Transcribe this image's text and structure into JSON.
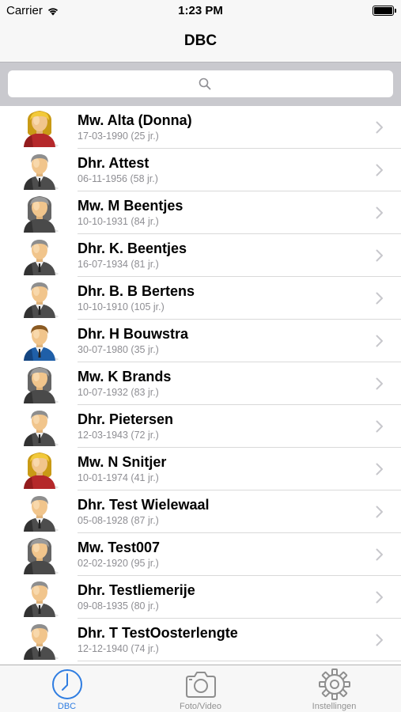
{
  "status_bar": {
    "carrier": "Carrier",
    "time": "1:23 PM"
  },
  "nav": {
    "title": "DBC"
  },
  "search": {
    "placeholder": ""
  },
  "patients": [
    {
      "name": "Mw. Alta (Donna)",
      "date": "17-03-1990 (25 jr.)",
      "avatar": "female-blonde-avatar-icon"
    },
    {
      "name": "Dhr. Attest",
      "date": "06-11-1956 (58 jr.)",
      "avatar": "male-grey-hair-avatar-icon"
    },
    {
      "name": "Mw. M Beentjes",
      "date": "10-10-1931 (84 jr.)",
      "avatar": "female-grey-hair-avatar-icon"
    },
    {
      "name": "Dhr. K. Beentjes",
      "date": "16-07-1934 (81 jr.)",
      "avatar": "male-grey-hair-avatar-icon"
    },
    {
      "name": "Dhr. B. B Bertens",
      "date": "10-10-1910 (105 jr.)",
      "avatar": "male-grey-hair-avatar-icon"
    },
    {
      "name": "Dhr. H Bouwstra",
      "date": "30-07-1980 (35 jr.)",
      "avatar": "male-brown-hair-avatar-icon"
    },
    {
      "name": "Mw. K Brands",
      "date": "10-07-1932 (83 jr.)",
      "avatar": "female-grey-hair-avatar-icon"
    },
    {
      "name": "Dhr. Pietersen",
      "date": "12-03-1943 (72 jr.)",
      "avatar": "male-grey-hair-avatar-icon"
    },
    {
      "name": "Mw. N Snitjer",
      "date": "10-01-1974 (41 jr.)",
      "avatar": "female-blonde-avatar-icon"
    },
    {
      "name": "Dhr. Test Wielewaal",
      "date": "05-08-1928 (87 jr.)",
      "avatar": "male-grey-hair-avatar-icon"
    },
    {
      "name": "Mw. Test007",
      "date": "02-02-1920 (95 jr.)",
      "avatar": "female-grey-hair-avatar-icon"
    },
    {
      "name": "Dhr. Testliemerije",
      "date": "09-08-1935 (80 jr.)",
      "avatar": "male-grey-hair-avatar-icon"
    },
    {
      "name": "Dhr. T TestOosterlengte",
      "date": "12-12-1940 (74 jr.)",
      "avatar": "male-grey-hair-avatar-icon"
    },
    {
      "name": "",
      "date": "",
      "avatar": "male-grey-hair-avatar-icon"
    }
  ],
  "tabs": [
    {
      "label": "DBC",
      "icon": "clock-icon",
      "active": true
    },
    {
      "label": "Foto/Video",
      "icon": "camera-icon",
      "active": false
    },
    {
      "label": "Instellingen",
      "icon": "gear-icon",
      "active": false
    }
  ],
  "colors": {
    "accent": "#2f7de1",
    "inactive": "#929292",
    "search_bg": "#c9c9ce"
  }
}
